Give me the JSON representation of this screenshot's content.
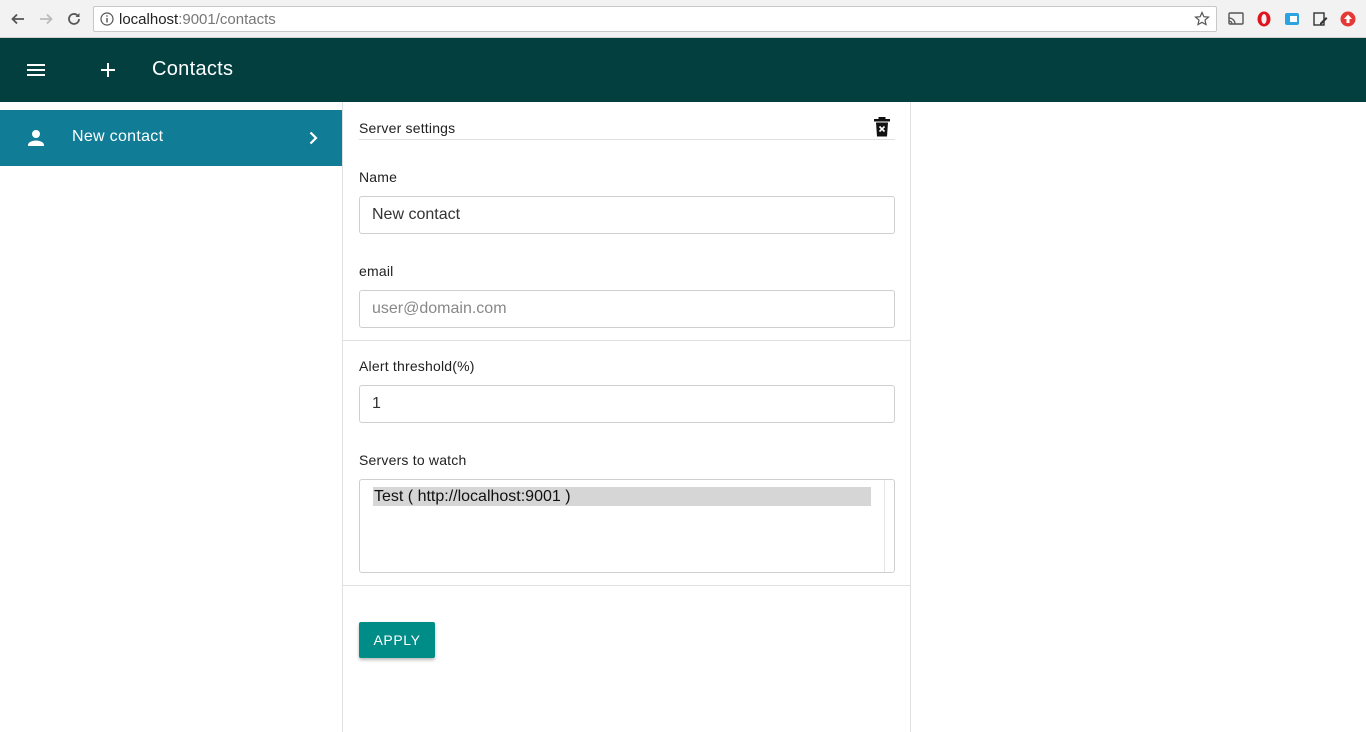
{
  "browser": {
    "url_host": "localhost",
    "url_path": ":9001/contacts"
  },
  "toolbar": {
    "title": "Contacts"
  },
  "sidebar": {
    "items": [
      {
        "label": "New contact"
      }
    ]
  },
  "panel": {
    "section_title": "Server settings",
    "name_label": "Name",
    "name_value": "New contact",
    "email_label": "email",
    "email_placeholder": "user@domain.com",
    "threshold_label": "Alert threshold(%)",
    "threshold_value": "1",
    "servers_label": "Servers to watch",
    "servers_options": [
      "Test ( http://localhost:9001 )"
    ],
    "apply_label": "APPLY"
  },
  "colors": {
    "toolbar_bg": "#033f3f",
    "sidebar_active_bg": "#117c96",
    "apply_bg": "#008c87"
  }
}
